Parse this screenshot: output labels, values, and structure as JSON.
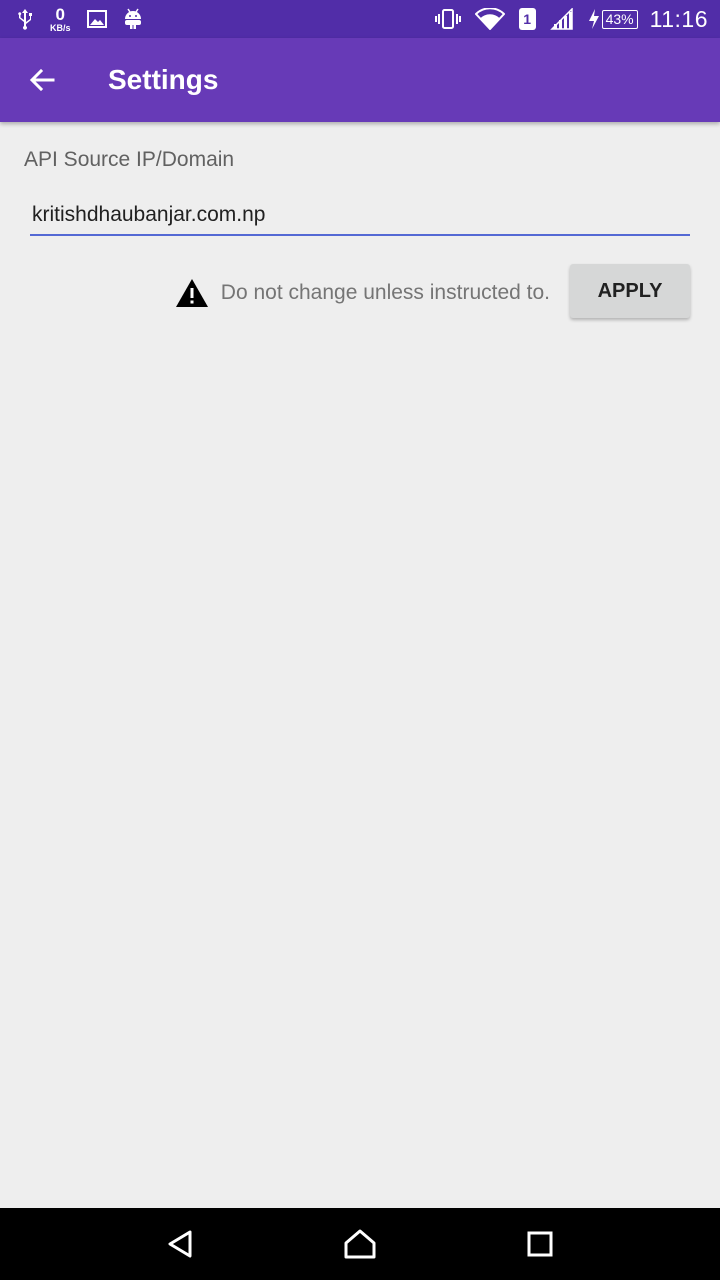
{
  "status_bar": {
    "net_speed_value": "0",
    "net_speed_unit": "KB/s",
    "sim_slot": "1",
    "battery_percent": "43%",
    "time": "11:16",
    "icons": [
      "usb-icon",
      "image-icon",
      "android-icon",
      "vibrate-icon",
      "wifi-icon",
      "signal-icon",
      "charging-icon"
    ]
  },
  "app_bar": {
    "title": "Settings",
    "back_icon": "arrow-back-icon"
  },
  "settings": {
    "field_label": "API Source IP/Domain",
    "domain_value": "kritishdhaubanjar.com.np",
    "warning_text": "Do not change unless instructed to.",
    "apply_label": "APPLY"
  },
  "nav_bar": {
    "icons": [
      "back-triangle-icon",
      "home-icon",
      "recents-icon"
    ]
  },
  "colors": {
    "status_bar": "#512da8",
    "app_bar": "#673ab7",
    "background": "#eeeeee",
    "input_underline": "#5469d4",
    "button": "#d6d7d7"
  }
}
